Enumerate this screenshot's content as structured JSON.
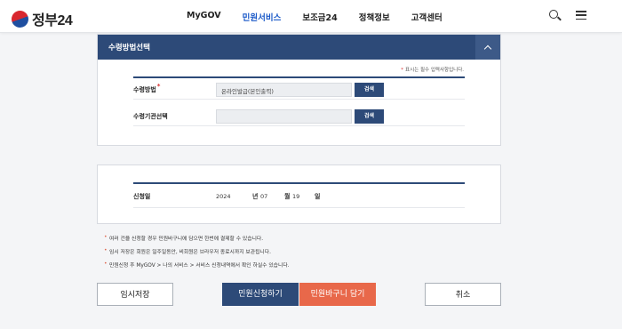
{
  "header": {
    "logo_text": "정부24",
    "nav": [
      "MyGOV",
      "민원서비스",
      "보조금24",
      "정책정보",
      "고객센터"
    ],
    "active_nav": "민원서비스"
  },
  "receive_section": {
    "title": "수령방법선택",
    "required_note": "표시는 필수 입력사항입니다.",
    "rows": [
      {
        "label": "수령방법",
        "required": true,
        "value": "온라인발급(본인출력)",
        "button": "검색"
      },
      {
        "label": "수령기관선택",
        "required": false,
        "value": "",
        "button": "검색"
      }
    ]
  },
  "application_date": {
    "label": "신청일",
    "year": "2024",
    "year_unit": "년",
    "month": "07",
    "month_unit": "월",
    "day": "19",
    "day_unit": "일"
  },
  "notes": [
    "여러 건을 신청할 경우 민원바구니에 담으면 한번에 결제할 수 있습니다.",
    "임시 저장은 회원은 일주일동안, 비회원은 브라우저 종료시까지 보관됩니다.",
    "민원신청 후 MyGOV > 나의 서비스 > 서비스 신청내역에서 확인 하실수 있습니다."
  ],
  "buttons": {
    "temp_save": "임시저장",
    "apply": "민원신청하기",
    "cart": "민원바구니 담기",
    "cancel": "취소"
  },
  "colors": {
    "navy": "#2d4a78",
    "accent_orange": "#e8684a",
    "active_nav": "#1a59c8",
    "required_star": "#d72c2c"
  }
}
